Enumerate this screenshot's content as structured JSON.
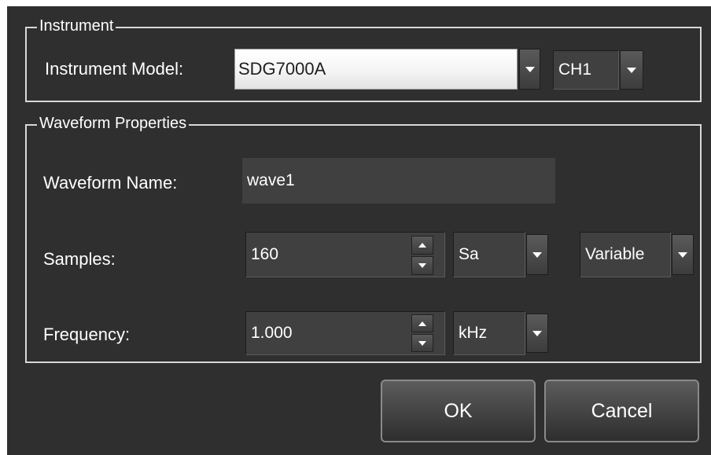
{
  "instrument_group": {
    "title": "Instrument",
    "model_label": "Instrument Model:",
    "model_value": "SDG7000A",
    "channel_value": "CH1"
  },
  "waveform_group": {
    "title": "Waveform Properties",
    "name_label": "Waveform Name:",
    "name_value": "wave1",
    "samples_label": "Samples:",
    "samples_value": "160",
    "samples_unit": "Sa",
    "samples_mode": "Variable",
    "frequency_label": "Frequency:",
    "frequency_value": "1.000",
    "frequency_unit": "kHz"
  },
  "buttons": {
    "ok_label": "OK",
    "cancel_label": "Cancel"
  },
  "colors": {
    "dialog_bg": "#2f2f2f",
    "field_bg": "#404040",
    "group_border": "#d8d8d8"
  },
  "icons": {
    "dropdown": "chevron-down-icon",
    "spin_up": "arrow-up-icon",
    "spin_down": "arrow-down-icon"
  }
}
